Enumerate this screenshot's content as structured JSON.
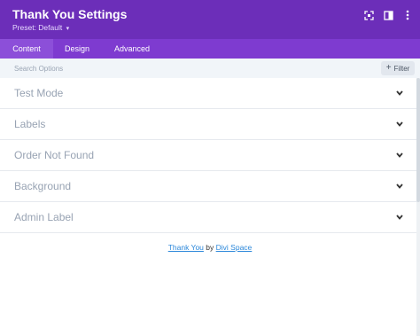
{
  "header": {
    "title": "Thank You Settings",
    "preset_label": "Preset: Default",
    "preset_caret": "▾",
    "icons": [
      "expand-icon",
      "sidebar-layout-icon",
      "more-vertical-icon"
    ]
  },
  "tabs": [
    {
      "label": "Content",
      "active": true
    },
    {
      "label": "Design",
      "active": false
    },
    {
      "label": "Advanced",
      "active": false
    }
  ],
  "search": {
    "placeholder": "Search Options",
    "filter_label": "Filter",
    "filter_icon": "+"
  },
  "sections": [
    {
      "label": "Test Mode"
    },
    {
      "label": "Labels"
    },
    {
      "label": "Order Not Found"
    },
    {
      "label": "Background"
    },
    {
      "label": "Admin Label"
    }
  ],
  "footer": {
    "link1": "Thank You",
    "by": "by",
    "link2": "Divi Space"
  },
  "colors": {
    "header": "#6c2eb9",
    "tabs": "#7e3bd0",
    "active_tab": "#8c4fd9",
    "link": "#2b87da"
  }
}
